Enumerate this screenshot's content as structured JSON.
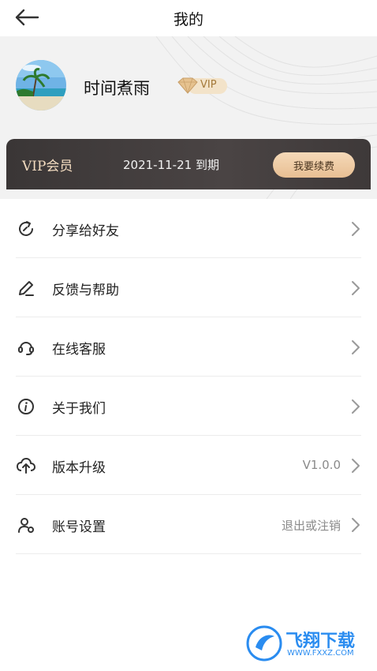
{
  "header": {
    "title": "我的"
  },
  "profile": {
    "username": "时间煮雨",
    "vip_badge": "VIP"
  },
  "vip_card": {
    "title": "VIP会员",
    "expiry": "2021-11-21 到期",
    "renew_label": "我要续费"
  },
  "menu": {
    "items": [
      {
        "label": "分享给好友",
        "icon": "share-icon",
        "value": ""
      },
      {
        "label": "反馈与帮助",
        "icon": "pencil-icon",
        "value": ""
      },
      {
        "label": "在线客服",
        "icon": "headset-icon",
        "value": ""
      },
      {
        "label": "关于我们",
        "icon": "info-icon",
        "value": ""
      },
      {
        "label": "版本升级",
        "icon": "cloud-upload-icon",
        "value": "V1.0.0"
      },
      {
        "label": "账号设置",
        "icon": "user-icon",
        "value": "退出或注销"
      }
    ]
  },
  "watermark": {
    "name": "飞翔下载",
    "url": "WWW.FXXZ.COM"
  },
  "colors": {
    "vip_card_bg": "#3a3636",
    "vip_gold": "#e8bf93",
    "vip_text": "#f3dcc0"
  }
}
